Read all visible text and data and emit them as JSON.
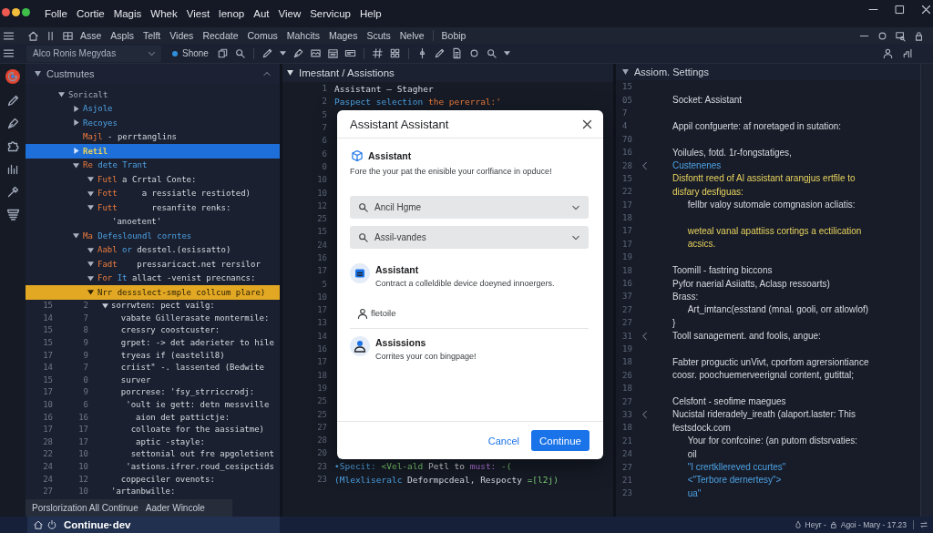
{
  "menu": [
    "Folle",
    "Cortie",
    "Magis",
    "Whek",
    "Viest",
    "lenop",
    "Aut",
    "View",
    "Servicup",
    "Help"
  ],
  "toolbar": {
    "items": [
      "Asse",
      "Aspls",
      "Telft",
      "Vides",
      "Recdate",
      "Comus",
      "Mahcits",
      "Mages",
      "Scuts",
      "Nelve"
    ],
    "extra": "Bobip"
  },
  "secondary_toolbar": {
    "project": "Alco Ronis Megydas",
    "branch": "Shone"
  },
  "left_panel": {
    "title": "Custmutes",
    "tree": [
      {
        "label": [
          {
            "text": "Soricalt",
            "kind": "muted"
          }
        ],
        "expanded": true,
        "selected": false,
        "highlighted": false,
        "children": [
          {
            "label": [
              {
                "text": "Asjole",
                "kind": "type"
              }
            ],
            "expanded": false,
            "selected": false,
            "highlighted": false
          },
          {
            "label": [
              {
                "text": "Recoyes",
                "kind": "type"
              }
            ],
            "expanded": false,
            "selected": false,
            "highlighted": false
          },
          {
            "label": [
              {
                "text": "Majl",
                "kind": "keyword"
              },
              {
                "text": " - perrtanglins",
                "kind": "plain"
              }
            ],
            "selected": false,
            "highlighted": false
          },
          {
            "label": [
              {
                "text": "Retil",
                "kind": "string"
              }
            ],
            "expanded": false,
            "selected": true,
            "highlighted": false
          },
          {
            "label": [
              {
                "text": "Re",
                "kind": "keyword"
              },
              {
                "text": " dete Trant",
                "kind": "type"
              }
            ],
            "expanded": true,
            "selected": false,
            "highlighted": false,
            "children": [
              {
                "label": [
                  {
                    "text": "Futl",
                    "kind": "keyword"
                  },
                  {
                    "text": " a Crrtal Conte:",
                    "kind": "plain"
                  }
                ],
                "expanded": true,
                "selected": false,
                "highlighted": false
              },
              {
                "label": [
                  {
                    "text": "Fott",
                    "kind": "keyword"
                  },
                  {
                    "text": "     a ressiatle restioted)",
                    "kind": "plain"
                  }
                ],
                "expanded": true,
                "selected": false,
                "highlighted": false
              },
              {
                "label": [
                  {
                    "text": "Futt",
                    "kind": "keyword"
                  },
                  {
                    "text": "       resanfite renks:",
                    "kind": "plain"
                  }
                ],
                "expanded": true,
                "selected": false,
                "highlighted": false,
                "children": [
                  {
                    "label": [
                      {
                        "text": "'anoetent'",
                        "kind": "plain"
                      }
                    ],
                    "selected": false,
                    "highlighted": false
                  }
                ]
              }
            ]
          },
          {
            "label": [
              {
                "text": "Ma",
                "kind": "keyword"
              },
              {
                "text": " Defesloundl corntes",
                "kind": "type"
              }
            ],
            "expanded": true,
            "selected": false,
            "highlighted": false,
            "children": [
              {
                "label": [
                  {
                    "text": "Aabl",
                    "kind": "keyword"
                  },
                  {
                    "text": " or",
                    "kind": "type"
                  },
                  {
                    "text": " desstel.(esissatto)",
                    "kind": "plain"
                  }
                ],
                "expanded": true,
                "selected": false,
                "highlighted": false
              },
              {
                "label": [
                  {
                    "text": "Fadt",
                    "kind": "keyword"
                  },
                  {
                    "text": "    pressaricact.net rersilor",
                    "kind": "plain"
                  }
                ],
                "expanded": true,
                "selected": false,
                "highlighted": false
              },
              {
                "label": [
                  {
                    "text": "For",
                    "kind": "keyword"
                  },
                  {
                    "text": " It",
                    "kind": "type"
                  },
                  {
                    "text": " allact -venist precnancs:",
                    "kind": "plain"
                  }
                ],
                "expanded": true,
                "selected": false,
                "highlighted": false
              },
              {
                "label": [
                  {
                    "text": "Nrr dessslect-smple collcum plare)",
                    "kind": "plain"
                  }
                ],
                "expanded": true,
                "selected": false,
                "highlighted": true
              }
            ]
          }
        ]
      }
    ],
    "code_lines": [
      {
        "gutter": [
          "15",
          "2"
        ],
        "expanded": true,
        "text": "sorrwten: pect vailg:"
      },
      {
        "gutter": [
          "14",
          "7"
        ],
        "text": "  vabate Gillerasate montermile:"
      },
      {
        "gutter": [
          "15",
          "8"
        ],
        "text": "  cressry coostcuster:"
      },
      {
        "gutter": [
          "15",
          "9"
        ],
        "text": "  grpet: -> det aderieter to hile"
      },
      {
        "gutter": [
          "17",
          "9"
        ],
        "text": "  tryeas if (eastelil8)"
      },
      {
        "gutter": [
          "14",
          "7"
        ],
        "text": "  criist\" -. lassented (Bedwite"
      },
      {
        "gutter": [
          "15",
          "0"
        ],
        "text": "  surver"
      },
      {
        "gutter": [
          "17",
          "9"
        ],
        "text": "  porcrese: 'fsy_strriccrodj:"
      },
      {
        "gutter": [
          "10",
          "6"
        ],
        "text": "   'oult ie gett: detn messville"
      },
      {
        "gutter": [
          "16",
          "16"
        ],
        "text": "     aion det pattictje:"
      },
      {
        "gutter": [
          "17",
          "17"
        ],
        "text": "    colloate for the aassiatme)"
      },
      {
        "gutter": [
          "28",
          "17"
        ],
        "text": "     aptic -stayle:"
      },
      {
        "gutter": [
          "22",
          "10"
        ],
        "text": "    settonial out fre apgoletient"
      },
      {
        "gutter": [
          "24",
          "10"
        ],
        "text": "   'astions.ifrer.roud_cesipctids"
      },
      {
        "gutter": [
          "24",
          "12"
        ],
        "text": "  coppeciler ovenots:"
      },
      {
        "gutter": [
          "27",
          "10"
        ],
        "text": "'artanbwille:"
      }
    ],
    "footer": [
      "Porslorization All Continue",
      "Aader Wincole"
    ]
  },
  "editor": {
    "title": "Imestant / Assistions",
    "lines": [
      {
        "number": "1",
        "segments": [
          {
            "text": "Assistant – Stagher",
            "kind": "plain"
          }
        ]
      },
      {
        "number": "2",
        "segments": [
          {
            "text": "Paspect selection",
            "kind": "type"
          },
          {
            "text": " the pererral:'",
            "kind": "keyword"
          }
        ]
      },
      {
        "number": "5"
      },
      {
        "number": "7"
      },
      {
        "number": "6"
      },
      {
        "number": "6"
      },
      {
        "number": "0"
      },
      {
        "number": "10"
      },
      {
        "number": "10"
      },
      {
        "number": "12"
      },
      {
        "number": "25"
      },
      {
        "number": "15"
      },
      {
        "number": "24"
      },
      {
        "number": "16"
      },
      {
        "number": "17"
      },
      {
        "number": "5"
      },
      {
        "number": "10"
      },
      {
        "number": "17"
      },
      {
        "number": "13"
      },
      {
        "number": "14"
      },
      {
        "number": "16"
      },
      {
        "number": "17"
      },
      {
        "number": "18"
      },
      {
        "number": "19"
      },
      {
        "number": "25"
      },
      {
        "number": "25"
      },
      {
        "number": "27"
      },
      {
        "number": "28"
      },
      {
        "number": "20"
      },
      {
        "number": "23",
        "segments": [
          {
            "text": "•Specit:",
            "kind": "type"
          },
          {
            "text": " <Vel-ald",
            "kind": "literal"
          },
          {
            "text": " Petl to",
            "kind": "plain"
          },
          {
            "text": " must:",
            "kind": "property"
          },
          {
            "text": " -(",
            "kind": "literal"
          }
        ]
      },
      {
        "number": "23",
        "segments": [
          {
            "text": "(Mlexliseralc",
            "kind": "type"
          },
          {
            "text": " Deformpcdeal, Respocty",
            "kind": "plain"
          },
          {
            "text": " =[l2j)",
            "kind": "literal"
          }
        ]
      }
    ]
  },
  "dialog": {
    "title": "Assistant Assistant",
    "heading": "Assistant",
    "description": "Fore the your pat the enisible your corlfiance in opduce!",
    "fields": [
      {
        "value": "Ancil Hgme"
      },
      {
        "value": "Assil-vandes"
      }
    ],
    "options": [
      {
        "kind": "app",
        "title": "Assistant",
        "description": "Contract a colleldible device doeyned innoergers."
      },
      {
        "kind": "account",
        "title": "fletoile"
      },
      {
        "kind": "user",
        "title": "Assissions",
        "description": "Corrites your con bingpage!"
      }
    ],
    "buttons": [
      {
        "kind": "secondary",
        "label": "Cancel"
      },
      {
        "kind": "primary",
        "label": "Continue"
      }
    ]
  },
  "settings_panel": {
    "title": "Assiom. Settings",
    "lines": [
      {
        "number": "15",
        "fold": false
      },
      {
        "number": "05",
        "fold": false,
        "text": "Socket: Assistant",
        "kind": "plain"
      },
      {
        "number": "7",
        "fold": false
      },
      {
        "number": "4",
        "fold": false,
        "text": "Appil confguerte: af noretaged in sutation:",
        "kind": "plain"
      },
      {
        "number": "70",
        "fold": false
      },
      {
        "number": "16",
        "fold": false,
        "text": "Yoilules, fotd. 1r-fongstatiges,",
        "kind": "plain"
      },
      {
        "number": "28",
        "fold": true,
        "text": "Custenenes",
        "kind": "type"
      },
      {
        "number": "15",
        "fold": false,
        "text": "Disfontt reed of Al assistant arangjus ertfile to",
        "kind": "string"
      },
      {
        "number": "22",
        "fold": false,
        "text": "disfary desfiguas:",
        "kind": "string"
      },
      {
        "number": "17",
        "fold": false,
        "text": "      fellbr valoy sutomale comgnasion acliatis:",
        "kind": "plain"
      },
      {
        "number": "18",
        "fold": false
      },
      {
        "number": "17",
        "fold": false,
        "text": "      weteal vanal apattiiss cortings a ectilication",
        "kind": "string"
      },
      {
        "number": "17",
        "fold": false,
        "text": "      acsics.",
        "kind": "string"
      },
      {
        "number": "19",
        "fold": false
      },
      {
        "number": "18",
        "fold": false,
        "text": "Toomill - fastring biccons",
        "kind": "plain"
      },
      {
        "number": "16",
        "fold": false,
        "text": "Pyfor naerial Asiiatts, Aclasp ressoarts)",
        "kind": "plain"
      },
      {
        "number": "37",
        "fold": false,
        "text": "Brass:",
        "kind": "plain"
      },
      {
        "number": "27",
        "fold": false,
        "text": "      Art_imtanc(esstand (mnal. gooli, orr atlowlof)",
        "kind": "plain"
      },
      {
        "number": "27",
        "fold": false,
        "text": "}",
        "kind": "plain"
      },
      {
        "number": "31",
        "fold": true,
        "text": "Tooll sanagement. and foolis, angue:",
        "kind": "plain"
      },
      {
        "number": "19",
        "fold": false
      },
      {
        "number": "18",
        "fold": false,
        "text": "Fabter proguctic unVivt, cporfom agrersiontiance",
        "kind": "plain"
      },
      {
        "number": "26",
        "fold": false,
        "text": "coosr. poochuemerveerignal content, gutittal;",
        "kind": "plain"
      },
      {
        "number": "18",
        "fold": false
      },
      {
        "number": "27",
        "fold": false,
        "text": "Celsfont - seofime maegues",
        "kind": "plain"
      },
      {
        "number": "33",
        "fold": true,
        "text": "Nucistal rideradely_ireath (alaport.laster: This",
        "kind": "plain"
      },
      {
        "number": "18",
        "fold": false,
        "text": "festsdock.com",
        "kind": "plain"
      },
      {
        "number": "21",
        "fold": false,
        "text": "      Your for confcoine: (an putom distsrvaties:",
        "kind": "plain"
      },
      {
        "number": "24",
        "fold": false,
        "text": "      oil",
        "kind": "plain"
      },
      {
        "number": "27",
        "fold": false,
        "text": "      \"I crertkllereved ccurtes\"",
        "kind": "type"
      },
      {
        "number": "21",
        "fold": false,
        "text": "      <\"Terbore dernertesy\">",
        "kind": "type"
      },
      {
        "number": "23",
        "fold": false,
        "text": "      ua\"",
        "kind": "type"
      }
    ]
  },
  "status_bar": {
    "workspace": "Continue·dev",
    "items": [
      "Heyr -",
      "Agoi - Mary - 17.23"
    ]
  }
}
